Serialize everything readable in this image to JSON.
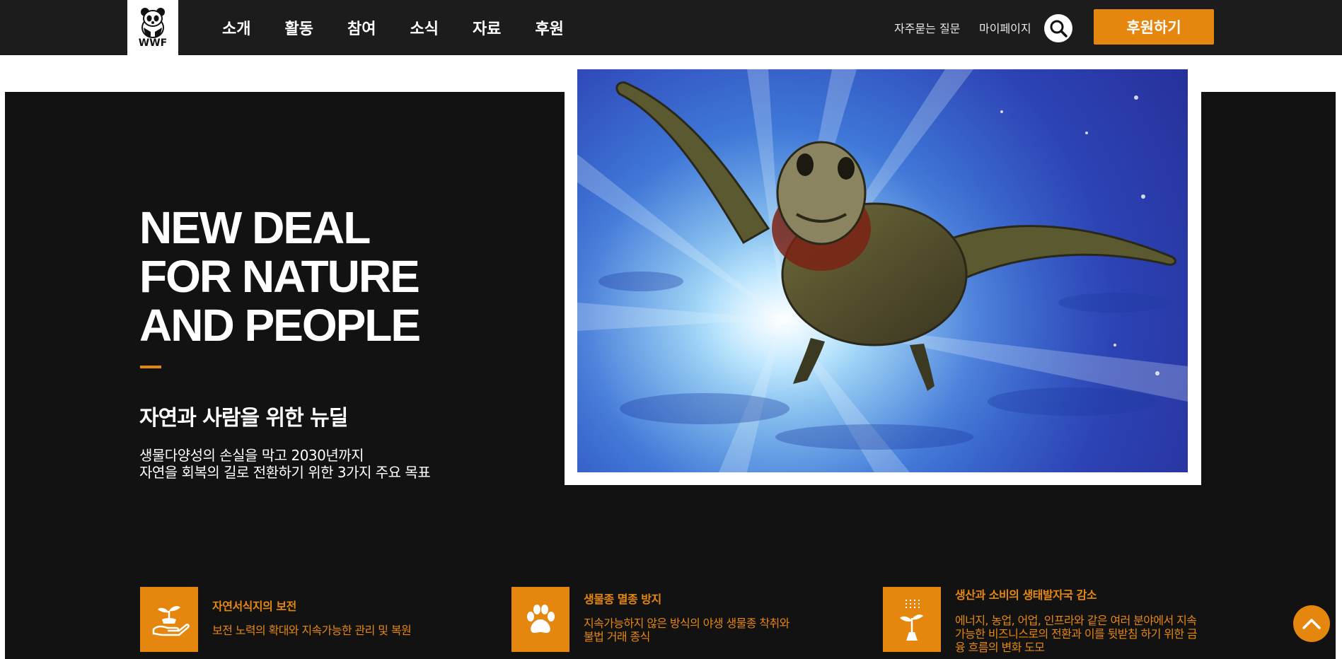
{
  "header": {
    "logo_text": "WWF",
    "nav": [
      "소개",
      "활동",
      "참여",
      "소식",
      "자료",
      "후원"
    ],
    "faq_label": "자주묻는 질문",
    "mypage_label": "마이페이지",
    "donate_label": "후원하기"
  },
  "hero": {
    "title": "NEW DEAL\nFOR NATURE\nAND PEOPLE",
    "subtitle": "자연과 사람을 위한 뉴딜",
    "desc_line1": "생물다양성의 손실을 막고 2030년까지",
    "desc_line2": "자연을 회복의 길로 전환하기 위한 3가지 주요 목표"
  },
  "goals": [
    {
      "title": "자연서식지의 보전",
      "desc": "보전 노력의 확대와 지속가능한 관리 및 복원",
      "icon": "hand-sprout-icon"
    },
    {
      "title": "생물종 멸종 방지",
      "desc": "지속가능하지 않은 방식의 야생 생물종 착취와 불법 거래 종식",
      "icon": "paw-icon"
    },
    {
      "title": "생산과 소비의 생태발자국 감소",
      "desc": "에너지, 농업, 어업, 인프라와 같은 여러 분야에서 지속가능한 비즈니스로의 전환과 이를 뒷받침 하기 위한 금융 흐름의 변화 도모",
      "icon": "plant-growth-icon"
    }
  ],
  "colors": {
    "accent": "#e5870f",
    "header_bg": "#1c1c1c",
    "hero_bg": "#121212"
  }
}
